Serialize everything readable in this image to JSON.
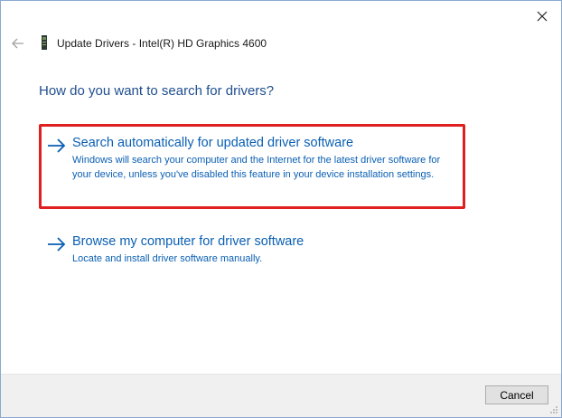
{
  "window": {
    "close_icon": "close-icon"
  },
  "header": {
    "back_icon": "back-arrow-icon",
    "device_icon": "display-adapter-icon",
    "title": "Update Drivers - Intel(R) HD Graphics 4600"
  },
  "main": {
    "heading": "How do you want to search for drivers?",
    "options": [
      {
        "icon": "arrow-right-icon",
        "title": "Search automatically for updated driver software",
        "description": "Windows will search your computer and the Internet for the latest driver software for your device, unless you've disabled this feature in your device installation settings.",
        "highlighted": true
      },
      {
        "icon": "arrow-right-icon",
        "title": "Browse my computer for driver software",
        "description": "Locate and install driver software manually.",
        "highlighted": false
      }
    ]
  },
  "footer": {
    "cancel_label": "Cancel"
  },
  "colors": {
    "link": "#0a5fb3",
    "heading": "#1f4e8f",
    "highlight_border": "#e02020",
    "footer_bg": "#f0f0f0"
  }
}
